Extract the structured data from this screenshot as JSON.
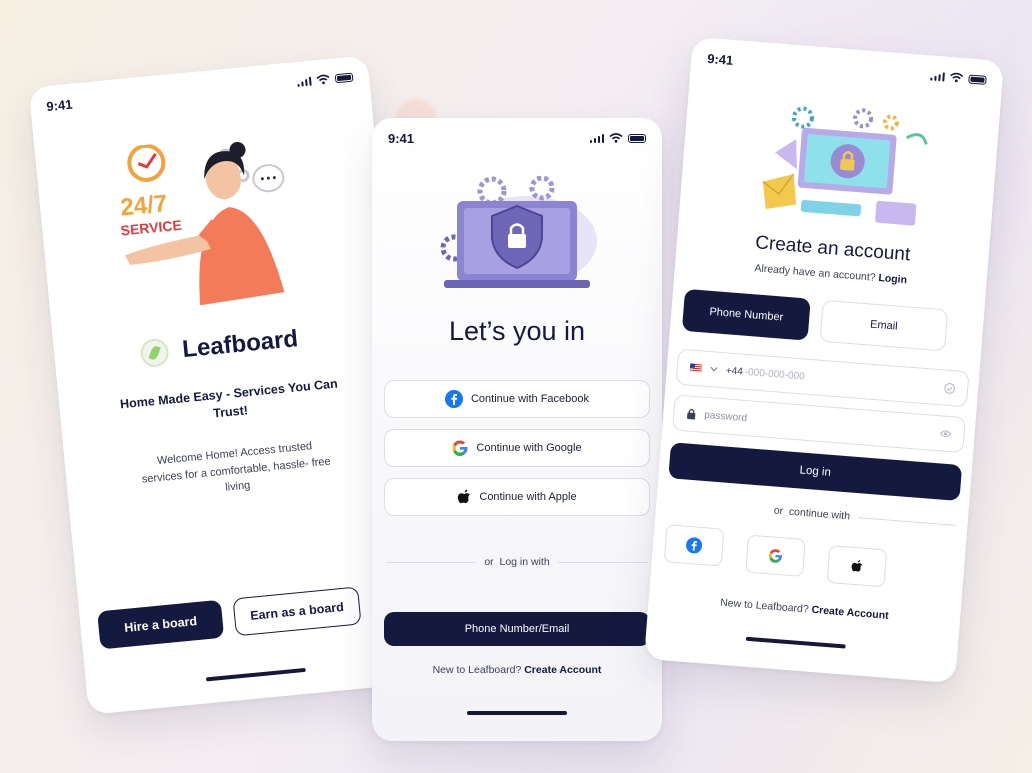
{
  "status_time": "9:41",
  "screen1": {
    "brand": "Leafboard",
    "illustration_text_1": "24/7",
    "illustration_text_2": "SERVICE",
    "tagline": "Home Made Easy - Services You Can Trust!",
    "description": "Welcome Home! Access trusted services for a comfortable, hassle- free living",
    "hire_button": "Hire a board",
    "earn_button": "Earn as a board"
  },
  "screen2": {
    "title": "Let’s you in",
    "facebook_label": "Continue with Facebook",
    "google_label": "Continue with Google",
    "apple_label": "Continue with Apple",
    "divider_text": "or  Log in with",
    "phone_email_button": "Phone Number/Email",
    "signup_prompt": "New to Leafboard?",
    "signup_link": "Create Account"
  },
  "screen3": {
    "title": "Create an account",
    "have_account_prompt": "Already have an account?",
    "login_link": "Login",
    "tab_phone": "Phone Number",
    "tab_email": "Email",
    "phone_prefix": "+44",
    "phone_placeholder": "-000-000-000",
    "password_placeholder": "password",
    "login_button": "Log in",
    "divider_text": "or  continue with",
    "signup_prompt": "New to Leafboard?",
    "signup_link": "Create Account"
  },
  "colors": {
    "primary": "#13193f",
    "facebook": "#1877f2",
    "accent_purple": "#7b74c9",
    "accent_orange": "#f47b5a"
  },
  "icons": [
    "signal-icon",
    "wifi-icon",
    "battery-icon",
    "facebook-icon",
    "google-icon",
    "apple-icon",
    "lock-icon",
    "eye-icon",
    "check-icon",
    "flag-icon",
    "chevron-down-icon"
  ]
}
